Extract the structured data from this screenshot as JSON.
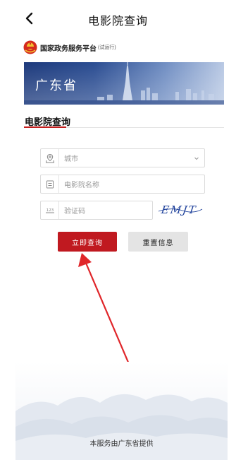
{
  "nav": {
    "title": "电影院查询",
    "back_icon": "chevron-left-icon"
  },
  "platform": {
    "name": "国家政务服务平台",
    "tag": "(试运行)",
    "emblem_icon": "national-emblem-icon"
  },
  "banner": {
    "title": "广东省"
  },
  "section": {
    "title": "电影院查询"
  },
  "form": {
    "city_placeholder": "城市",
    "cinema_name_placeholder": "电影院名称",
    "captcha_placeholder": "验证码",
    "captcha_text": "EMJT"
  },
  "buttons": {
    "query_label": "立即查询",
    "reset_label": "重置信息"
  },
  "footer": {
    "provider_text": "本服务由广东省提供"
  },
  "colors": {
    "accent_red": "#c01920",
    "banner_blue": "#1f3b7a",
    "captcha_ink": "#1c3f9a"
  }
}
